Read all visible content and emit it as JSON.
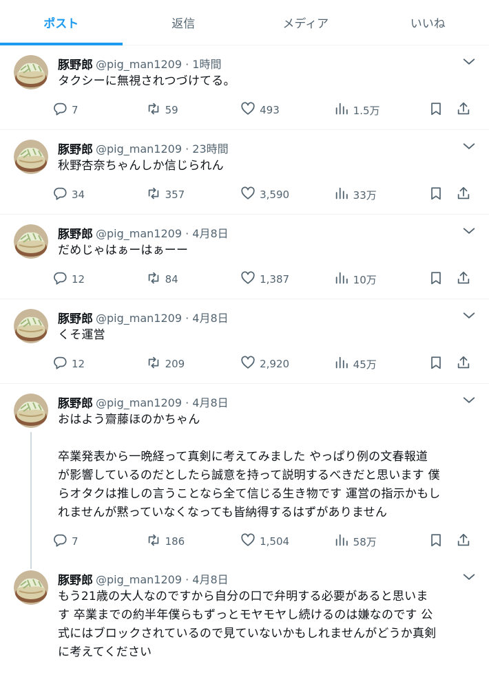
{
  "tabs": [
    {
      "label": "ポスト",
      "active": true
    },
    {
      "label": "返信",
      "active": false
    },
    {
      "label": "メディア",
      "active": false
    },
    {
      "label": "いいね",
      "active": false
    }
  ],
  "colors": {
    "accent": "#1d9bf0",
    "secondary_text": "#536471",
    "divider": "#eff3f4"
  },
  "tweets": [
    {
      "name": "豚野郎",
      "handle": "@pig_man1209 · 1時間",
      "text": "タクシーに無視されつづけてる。",
      "replies": "7",
      "retweets": "59",
      "likes": "493",
      "views": "1.5万"
    },
    {
      "name": "豚野郎",
      "handle": "@pig_man1209 · 23時間",
      "text": "秋野杏奈ちゃんしか信じられん",
      "replies": "34",
      "retweets": "357",
      "likes": "3,590",
      "views": "33万"
    },
    {
      "name": "豚野郎",
      "handle": "@pig_man1209 · 4月8日",
      "text": "だめじゃはぁーはぁーー",
      "replies": "12",
      "retweets": "84",
      "likes": "1,387",
      "views": "10万"
    },
    {
      "name": "豚野郎",
      "handle": "@pig_man1209 · 4月8日",
      "text": "くそ運営",
      "replies": "12",
      "retweets": "209",
      "likes": "2,920",
      "views": "45万"
    },
    {
      "name": "豚野郎",
      "handle": "@pig_man1209 · 4月8日",
      "text": "おはよう齋藤ほのかちゃん\n\n卒業発表から一晩経って真剣に考えてみました やっぱり例の文春報道\nが影響しているのだとしたら誠意を持って説明するべきだと思います 僕\nらオタクは推しの言うことなら全て信じる生き物です 運営の指示かもし\nれませんが黙っていなくなっても皆納得するはずがありません",
      "replies": "7",
      "retweets": "186",
      "likes": "1,504",
      "views": "58万"
    },
    {
      "name": "豚野郎",
      "handle": "@pig_man1209 · 4月8日",
      "text": "もう21歳の大人なのですから自分の口で弁明する必要があると思いま\nす 卒業までの約半年僕らもずっとモヤモヤし続けるのは嫌なのです 公\n式にはブロックされているので見ていないかもしれませんがどうか真剣\nに考えてください"
    }
  ],
  "icons": {
    "more": "chevron-down-icon",
    "reply": "reply-icon",
    "retweet": "retweet-icon",
    "like": "heart-icon",
    "views": "views-icon",
    "bookmark": "bookmark-icon",
    "share": "share-icon"
  }
}
